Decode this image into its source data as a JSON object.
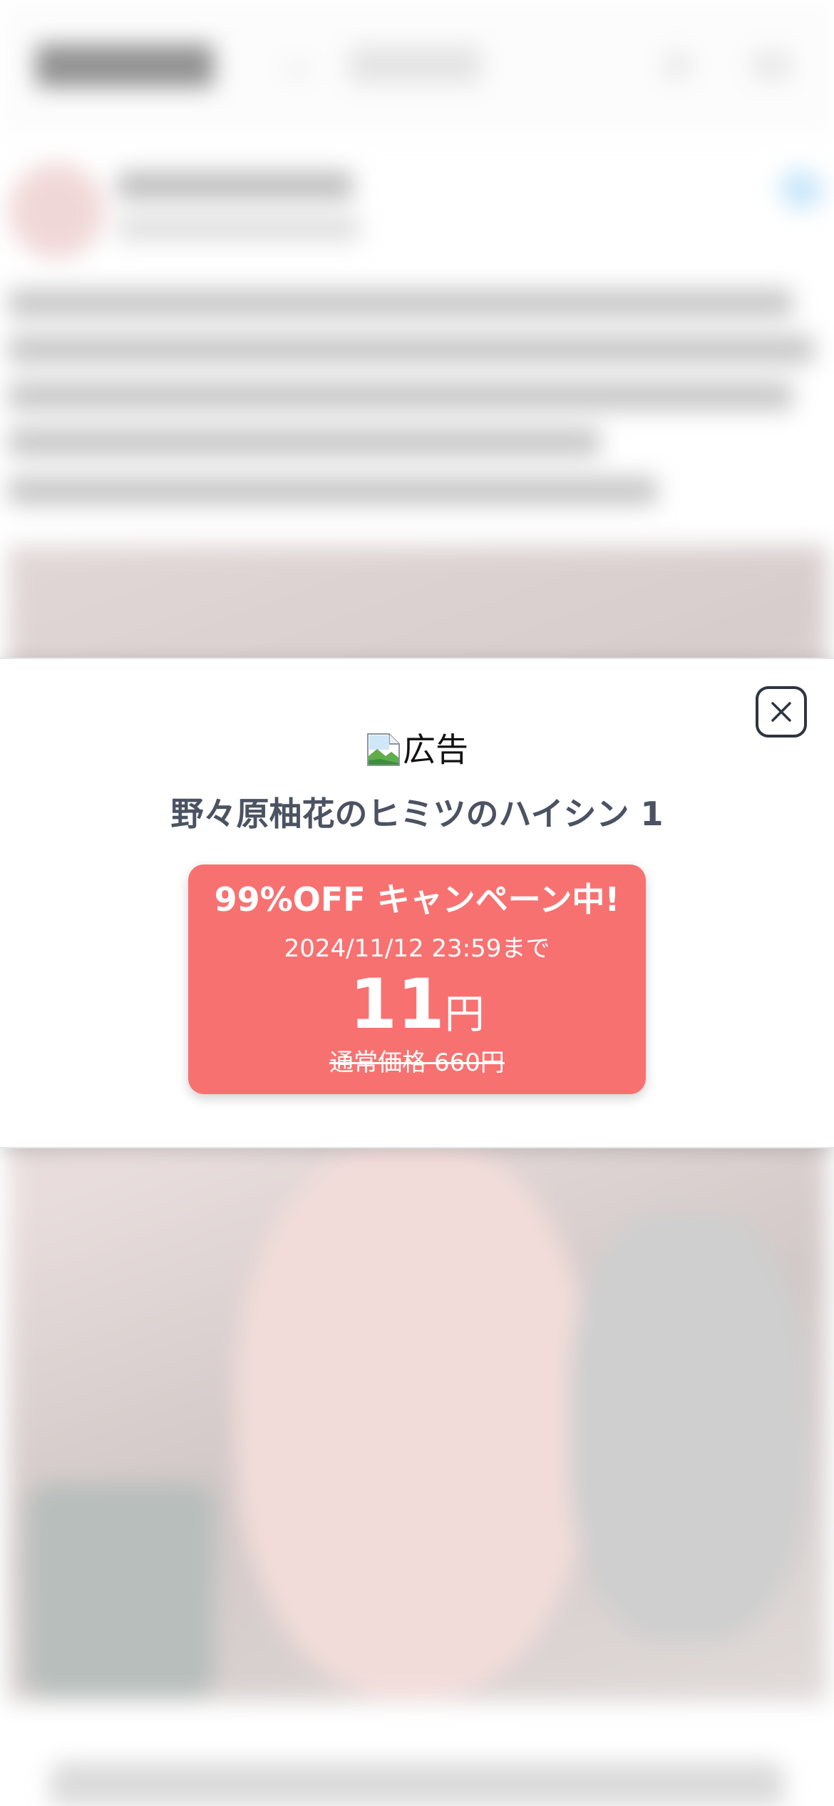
{
  "modal": {
    "ad_label": "広告",
    "product_title": "野々原柚花のヒミツのハイシン 1",
    "promo": {
      "headline": "99%OFF キャンペーン中!",
      "deadline": "2024/11/12 23:59まで",
      "price": "11",
      "price_unit": "円",
      "regular_price": "通常価格 660円"
    },
    "close_icon": "close-icon"
  },
  "colors": {
    "promo_background": "#f87171",
    "title_text": "#4b5262",
    "close_border": "#2f3440"
  }
}
